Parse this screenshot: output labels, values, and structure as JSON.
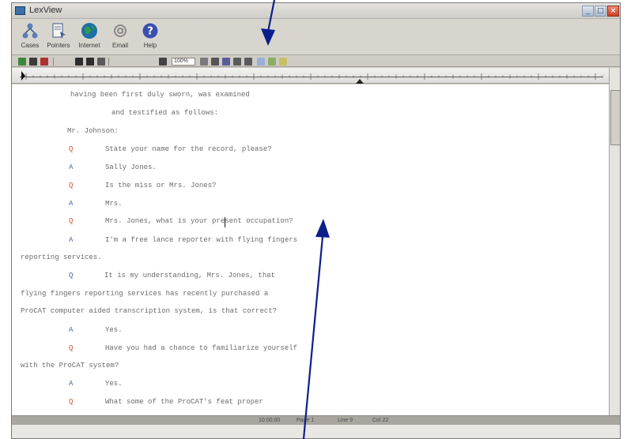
{
  "window": {
    "title": "LexView",
    "minimize_label": "_",
    "maximize_label": "□",
    "close_label": "×"
  },
  "toolbar": {
    "items": [
      {
        "label": "Cases",
        "icon": "cases-icon"
      },
      {
        "label": "Pointers",
        "icon": "pointers-icon"
      },
      {
        "label": "Internet",
        "icon": "globe-icon"
      },
      {
        "label": "Email",
        "icon": "email-icon"
      },
      {
        "label": "Help",
        "icon": "help-icon"
      }
    ]
  },
  "format_toolbar": {
    "zoom_value": "100%"
  },
  "transcript": {
    "lines": [
      {
        "marker": "",
        "marker_type": "",
        "text": "having been first duly sworn, was examined"
      },
      {
        "marker": "",
        "marker_type": "",
        "text": "and testified as follows:"
      },
      {
        "marker": "",
        "marker_type": "",
        "text": "Mr. Johnson:"
      },
      {
        "marker": "Q",
        "marker_type": "q",
        "text": "State your name for the record, please?"
      },
      {
        "marker": "A",
        "marker_type": "a",
        "text": "Sally Jones."
      },
      {
        "marker": "Q",
        "marker_type": "q",
        "text": "Is the miss or Mrs. Jones?"
      },
      {
        "marker": "A",
        "marker_type": "a",
        "text": "Mrs."
      },
      {
        "marker": "Q",
        "marker_type": "q",
        "text": "Mrs. Jones, what is your present occupation?"
      },
      {
        "marker": "A",
        "marker_type": "a",
        "text": "I'm a free lance reporter with flying fingers"
      },
      {
        "marker": "",
        "marker_type": "",
        "text": "reporting services."
      },
      {
        "marker": "Q",
        "marker_type": "a",
        "text": "It is my understanding, Mrs. Jones, that"
      },
      {
        "marker": "",
        "marker_type": "",
        "text": "flying fingers reporting services has recently purchased a"
      },
      {
        "marker": "",
        "marker_type": "",
        "text": "ProCAT computer aided transcription system, is that correct?"
      },
      {
        "marker": "A",
        "marker_type": "a",
        "text": "Yes."
      },
      {
        "marker": "Q",
        "marker_type": "q",
        "text": "Have you had a chance to familiarize yourself"
      },
      {
        "marker": "",
        "marker_type": "",
        "text": "with the ProCAT system?"
      },
      {
        "marker": "A",
        "marker_type": "a",
        "text": "Yes."
      },
      {
        "marker": "Q",
        "marker_type": "q",
        "text": "What some of the ProCAT's feat proper"
      }
    ]
  },
  "statusbar": {
    "time": "10:00:00",
    "page": "Page 1",
    "line": "Line 9",
    "col": "Col 22"
  },
  "colors": {
    "question_marker": "#c2573b",
    "answer_marker": "#4d5fa3",
    "annotation_arrow": "#0b1f8a"
  }
}
